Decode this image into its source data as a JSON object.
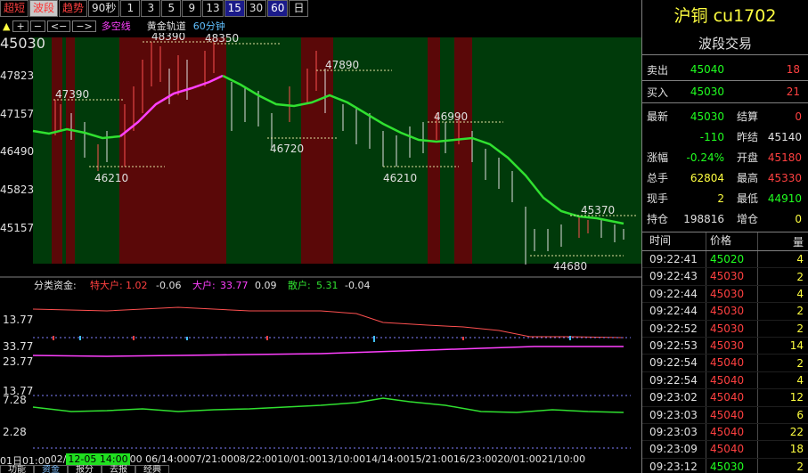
{
  "toolbar": {
    "buttons": [
      "超短",
      "波段",
      "趋势",
      "90秒",
      "1",
      "3",
      "5",
      "9",
      "13",
      "15",
      "30",
      "60",
      "日"
    ]
  },
  "toolbar2": {
    "arrow": "▲",
    "btn_plus": "+",
    "btn_minus": "−",
    "btn_left": "<−",
    "btn_right": "−>",
    "indicator_1": "多空线",
    "indicator_2": "黄金轨道",
    "indicator_3": "60分钟"
  },
  "main_chart": {
    "current_price": "45030",
    "y_ticks": [
      "47823",
      "47157",
      "46490",
      "45823",
      "45157"
    ],
    "annotations": [
      "48390",
      "48350",
      "47890",
      "47390",
      "46990",
      "46720",
      "46210",
      "46210",
      "45370",
      "44680"
    ]
  },
  "fund_panel": {
    "label": "分类资金:",
    "s1_name": "特大户:",
    "s1_val": "1.02",
    "s1_chg": "-0.06",
    "s2_name": "大户:",
    "s2_val": "33.77",
    "s2_chg": "0.09",
    "s3_name": "散户:",
    "s3_val": "5.31",
    "s3_chg": "-0.04",
    "y_ticks": [
      "13.77",
      "33.77",
      "23.77",
      "13.77",
      "7.28",
      "2.28"
    ]
  },
  "xaxis": {
    "labels": [
      "01日01:00",
      "02/",
      "12-05 14:00",
      "00 06/14:00",
      "07/21:00",
      "08/22:00",
      "10/01:00",
      "13/10:00",
      "14/14:00",
      "15/21:00",
      "16/23:00",
      "20/01:00",
      "21/10:00"
    ]
  },
  "bottom_tabs": [
    "功能",
    "资金",
    "报分",
    "去报",
    "经典"
  ],
  "right_panel": {
    "title": "沪铜 cu1702",
    "subtitle": "波段交易",
    "sell_label": "卖出",
    "sell_price": "45040",
    "sell_vol": "18",
    "buy_label": "买入",
    "buy_price": "45030",
    "buy_vol": "21",
    "stats": [
      {
        "l1": "最新",
        "v1": "45030",
        "c1": "green",
        "l2": "结算",
        "v2": "0",
        "c2": "red"
      },
      {
        "l1": "",
        "v1": "-110",
        "c1": "green",
        "l2": "昨结",
        "v2": "45140",
        "c2": "white"
      },
      {
        "l1": "涨幅",
        "v1": "-0.24%",
        "c1": "green",
        "l2": "开盘",
        "v2": "45180",
        "c2": "red"
      },
      {
        "l1": "总手",
        "v1": "62804",
        "c1": "yellow",
        "l2": "最高",
        "v2": "45330",
        "c2": "red"
      },
      {
        "l1": "现手",
        "v1": "2",
        "c1": "yellow",
        "l2": "最低",
        "v2": "44910",
        "c2": "green"
      },
      {
        "l1": "持仓",
        "v1": "198816",
        "c1": "white",
        "l2": "增仓",
        "v2": "0",
        "c2": "yellow"
      }
    ],
    "tick_headers": [
      "时间",
      "价格",
      "量"
    ],
    "ticks": [
      {
        "time": "09:22:41",
        "price": "45020",
        "color": "green",
        "vol": "4"
      },
      {
        "time": "09:22:43",
        "price": "45030",
        "color": "red",
        "vol": "2"
      },
      {
        "time": "09:22:44",
        "price": "45030",
        "color": "red",
        "vol": "4"
      },
      {
        "time": "09:22:44",
        "price": "45030",
        "color": "red",
        "vol": "2"
      },
      {
        "time": "09:22:52",
        "price": "45030",
        "color": "red",
        "vol": "2"
      },
      {
        "time": "09:22:53",
        "price": "45030",
        "color": "red",
        "vol": "14"
      },
      {
        "time": "09:22:54",
        "price": "45040",
        "color": "red",
        "vol": "2"
      },
      {
        "time": "09:22:54",
        "price": "45040",
        "color": "red",
        "vol": "4"
      },
      {
        "time": "09:23:02",
        "price": "45040",
        "color": "red",
        "vol": "12"
      },
      {
        "time": "09:23:03",
        "price": "45040",
        "color": "red",
        "vol": "6"
      },
      {
        "time": "09:23:03",
        "price": "45040",
        "color": "red",
        "vol": "22"
      },
      {
        "time": "09:23:09",
        "price": "45040",
        "color": "red",
        "vol": "18"
      },
      {
        "time": "09:23:12",
        "price": "45030",
        "color": "green",
        "vol": "2"
      }
    ]
  }
}
